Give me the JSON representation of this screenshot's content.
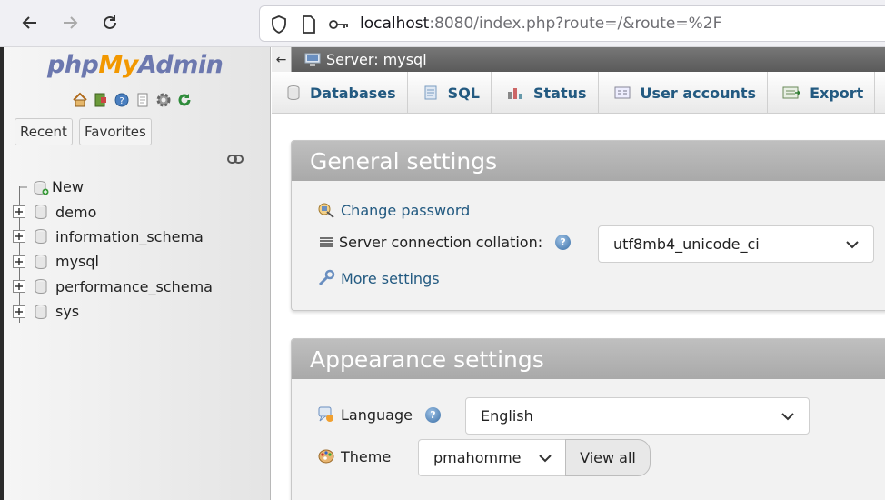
{
  "browser": {
    "url_host": "localhost",
    "url_rest": ":8080/index.php?route=/&route=%2F"
  },
  "sidebar": {
    "logo": {
      "php": "php",
      "my": "My",
      "admin": "Admin"
    },
    "quick_icons": [
      "home-icon",
      "exit-icon",
      "help-icon",
      "docs-icon",
      "settings-icon",
      "reload-icon"
    ],
    "recent_label": "Recent",
    "favorites_label": "Favorites",
    "tree": [
      {
        "label": "New",
        "type": "new"
      },
      {
        "label": "demo",
        "type": "db"
      },
      {
        "label": "information_schema",
        "type": "db"
      },
      {
        "label": "mysql",
        "type": "db"
      },
      {
        "label": "performance_schema",
        "type": "db"
      },
      {
        "label": "sys",
        "type": "db"
      }
    ]
  },
  "main": {
    "server_label": "Server: mysql",
    "tabs": [
      {
        "label": "Databases",
        "icon": "database-icon"
      },
      {
        "label": "SQL",
        "icon": "sql-icon"
      },
      {
        "label": "Status",
        "icon": "status-icon"
      },
      {
        "label": "User accounts",
        "icon": "users-icon"
      },
      {
        "label": "Export",
        "icon": "export-icon"
      }
    ],
    "general": {
      "title": "General settings",
      "change_password": "Change password",
      "collation_label": "Server connection collation:",
      "collation_value": "utf8mb4_unicode_ci",
      "more_settings": "More settings"
    },
    "appearance": {
      "title": "Appearance settings",
      "language_label": "Language",
      "language_value": "English",
      "theme_label": "Theme",
      "theme_value": "pmahomme",
      "view_all": "View all"
    }
  },
  "colors": {
    "link": "#235a81",
    "logo_blue": "#6c78af",
    "logo_orange": "#f29800",
    "panel_header": "#a9a9a9"
  }
}
